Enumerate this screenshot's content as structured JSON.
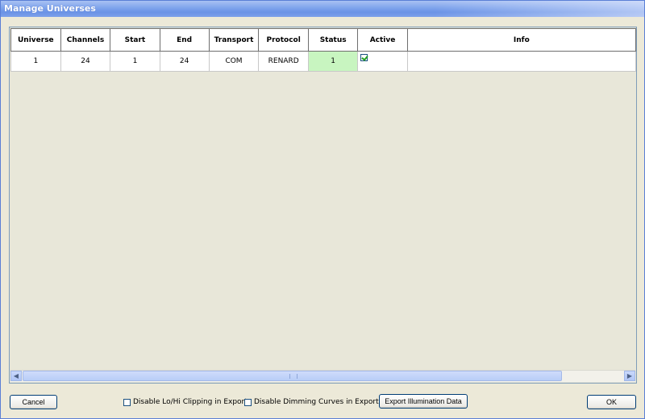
{
  "window": {
    "title": "Manage Universes"
  },
  "table": {
    "columns": [
      "Universe",
      "Channels",
      "Start",
      "End",
      "Transport",
      "Protocol",
      "Status",
      "Active",
      "Info"
    ],
    "rows": [
      {
        "universe": "1",
        "channels": "24",
        "start": "1",
        "end": "24",
        "transport": "COM",
        "protocol": "RENARD",
        "status": "1",
        "active": true,
        "info": ""
      }
    ]
  },
  "footer": {
    "cancel_label": "Cancel",
    "disable_clipping_label": "Disable Lo/Hi Clipping in Export",
    "disable_clipping_checked": false,
    "disable_dimming_label": "Disable Dimming Curves in Export",
    "disable_dimming_checked": false,
    "export_label": "Export Illumination Data",
    "ok_label": "OK"
  },
  "colors": {
    "status_ok": "#c8f5c0",
    "titlebar": "#7ea3ec",
    "dialog_bg": "#ece9d8"
  },
  "icons": {
    "scroll_left": "chevron-left-icon",
    "scroll_right": "chevron-right-icon",
    "checkbox": "checkbox-icon"
  }
}
